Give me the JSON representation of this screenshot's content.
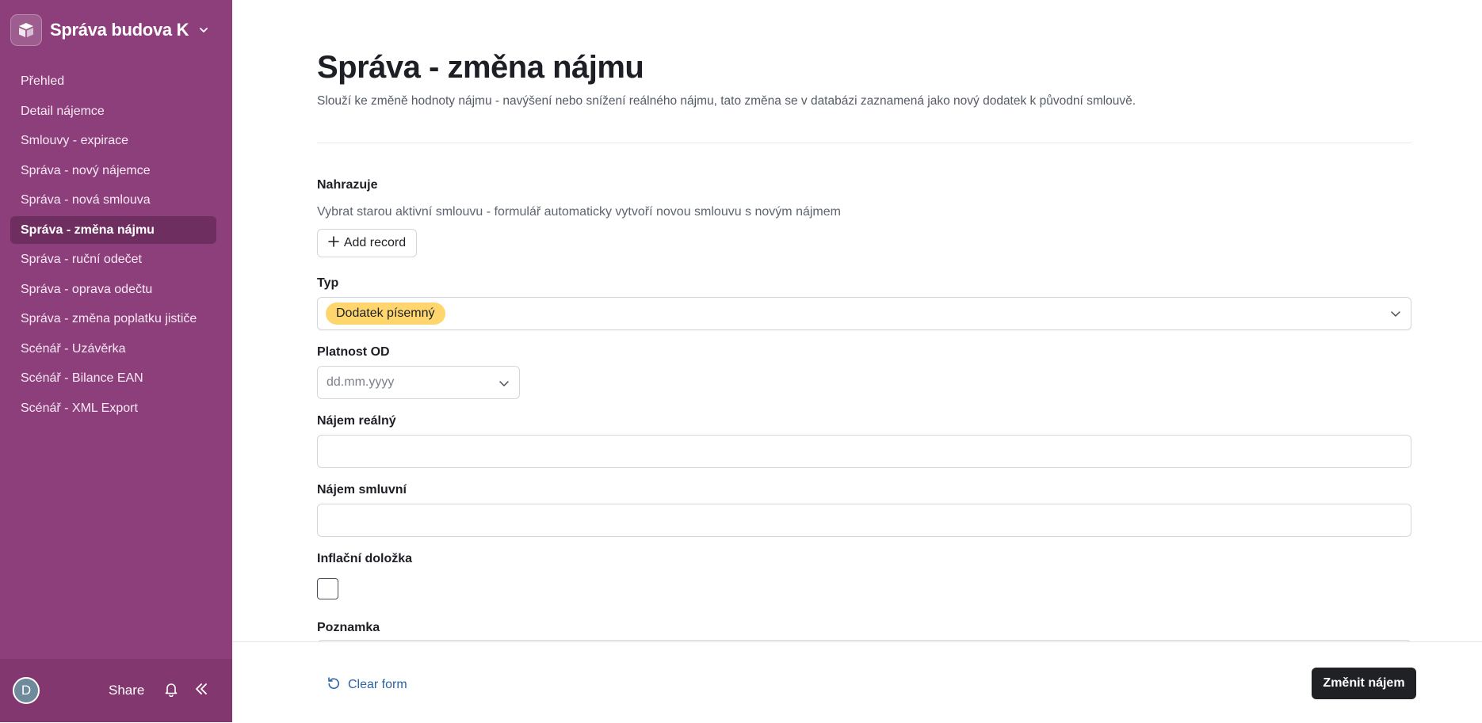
{
  "sidebar": {
    "app_name": "Správa budova K",
    "icons": {
      "logo": "box-logo-icon",
      "switcher": "chevron-down-icon"
    },
    "items": [
      {
        "label": "Přehled"
      },
      {
        "label": "Detail nájemce"
      },
      {
        "label": "Smlouvy - expirace"
      },
      {
        "label": "Správa - nový nájemce"
      },
      {
        "label": "Správa - nová smlouva"
      },
      {
        "label": "Správa - změna nájmu",
        "active": true
      },
      {
        "label": "Správa - ruční odečet"
      },
      {
        "label": "Správa - oprava odečtu"
      },
      {
        "label": "Správa - změna poplatku jističe"
      },
      {
        "label": "Scénář - Uzávěrka"
      },
      {
        "label": "Scénář - Bilance EAN"
      },
      {
        "label": "Scénář - XML Export"
      }
    ],
    "footer": {
      "avatar_initial": "D",
      "share_label": "Share",
      "icons": {
        "notifications": "bell-icon",
        "collapse": "double-chevron-left-icon"
      }
    }
  },
  "main": {
    "title": "Správa - změna nájmu",
    "description": "Slouží ke změně hodnoty nájmu - navýšení nebo snížení reálného nájmu, tato změna se v databázi zaznamená jako nový dodatek k původní smlouvě.",
    "fields": {
      "nahrazuje": {
        "label": "Nahrazuje",
        "hint": "Vybrat starou aktivní smlouvu - formulář automaticky vytvoří novou smlouvu s novým nájmem",
        "button_label": "Add record"
      },
      "typ": {
        "label": "Typ",
        "selected": "Dodatek písemný"
      },
      "platnost_od": {
        "label": "Platnost OD",
        "placeholder": "dd.mm.yyyy"
      },
      "najem_realny": {
        "label": "Nájem reálný",
        "value": ""
      },
      "najem_smluvni": {
        "label": "Nájem smluvní",
        "value": ""
      },
      "inflacni_dolozka": {
        "label": "Inflační doložka",
        "checked": false
      },
      "poznamka": {
        "label": "Poznamka"
      }
    },
    "footer": {
      "clear_label": "Clear form",
      "submit_label": "Změnit nájem"
    }
  },
  "colors": {
    "sidebar_bg": "#8c3f7a",
    "sidebar_active": "#6f2e60",
    "pill_yellow": "#ffd66e",
    "link_blue": "#2b63a6",
    "submit_bg": "#1f2125"
  }
}
